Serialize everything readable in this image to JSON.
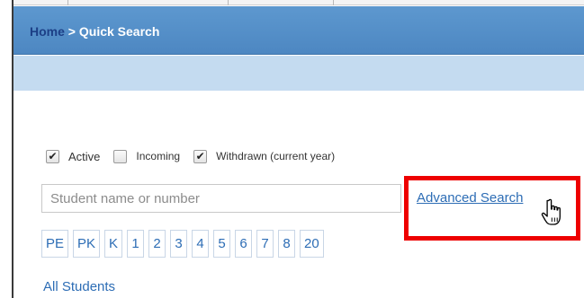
{
  "breadcrumb": {
    "home": "Home",
    "separator": " > ",
    "current": "Quick Search"
  },
  "filters": {
    "active": {
      "label": "Active",
      "checked": true
    },
    "incoming": {
      "label": "Incoming",
      "checked": false
    },
    "withdrawn": {
      "label": "Withdrawn (current year)",
      "checked": true
    }
  },
  "search": {
    "placeholder": "Student name or number",
    "value": ""
  },
  "advanced_search_label": "Advanced Search",
  "grades": [
    "PE",
    "PK",
    "K",
    "1",
    "2",
    "3",
    "4",
    "5",
    "6",
    "7",
    "8",
    "20"
  ],
  "all_students_label": "All Students",
  "colors": {
    "header": "#4d87c2",
    "sub_header": "#c4dbf0",
    "link": "#2d6db5",
    "highlight": "#ee0000"
  },
  "icons": {
    "cursor": "hand-pointer-icon"
  }
}
